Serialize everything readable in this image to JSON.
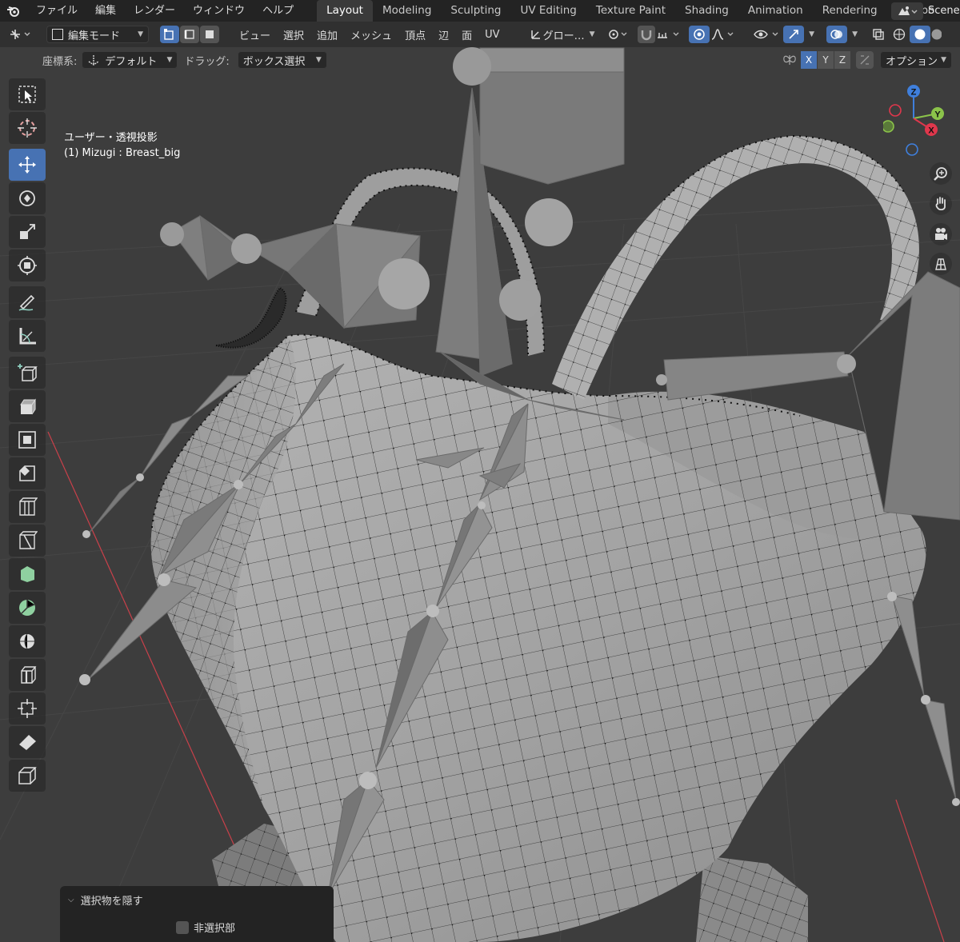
{
  "menu": {
    "items": [
      "ファイル",
      "編集",
      "レンダー",
      "ウィンドウ",
      "ヘルプ"
    ]
  },
  "workspaces": {
    "tabs": [
      "Layout",
      "Modeling",
      "Sculpting",
      "UV Editing",
      "Texture Paint",
      "Shading",
      "Animation",
      "Rendering",
      "Compo"
    ],
    "active": "Layout"
  },
  "scene": {
    "label": "Scene"
  },
  "header": {
    "mode": "編集モード",
    "view_menus": [
      "ビュー",
      "選択",
      "追加",
      "メッシュ",
      "頂点",
      "辺",
      "面",
      "UV"
    ],
    "transform_orientation": "グロー…",
    "select_mode_active": "vertex"
  },
  "header2": {
    "coord_label": "座標系:",
    "coord_value": "デフォルト",
    "drag_label": "ドラッグ:",
    "drag_value": "ボックス選択",
    "mirror_axes": [
      "X",
      "Y",
      "Z"
    ],
    "options_label": "オプション"
  },
  "viewport": {
    "view_name": "ユーザー・透視投影",
    "object_info": "(1) Mizugi : Breast_big",
    "gizmo_axes": [
      "Z",
      "Y",
      "X"
    ]
  },
  "tools": {
    "items": [
      "select-box",
      "cursor",
      "move",
      "rotate",
      "scale",
      "transform",
      "annotate",
      "measure",
      "add-cube",
      "extrude",
      "inset",
      "bevel",
      "loop-cut",
      "knife",
      "poly-build",
      "spin",
      "smooth",
      "edge-slide",
      "shrink-fatten",
      "shear",
      "rip-region"
    ],
    "active": "move"
  },
  "operator_panel": {
    "title": "選択物を隠す",
    "checkbox_label": "非選択部",
    "checkbox_checked": false
  },
  "colors": {
    "accent": "#4772b3",
    "background": "#3d3d3d",
    "mesh": "#a8a8a8",
    "x_axis": "#e0374c",
    "y_axis": "#8bc34a",
    "z_axis": "#3f7fdc"
  }
}
